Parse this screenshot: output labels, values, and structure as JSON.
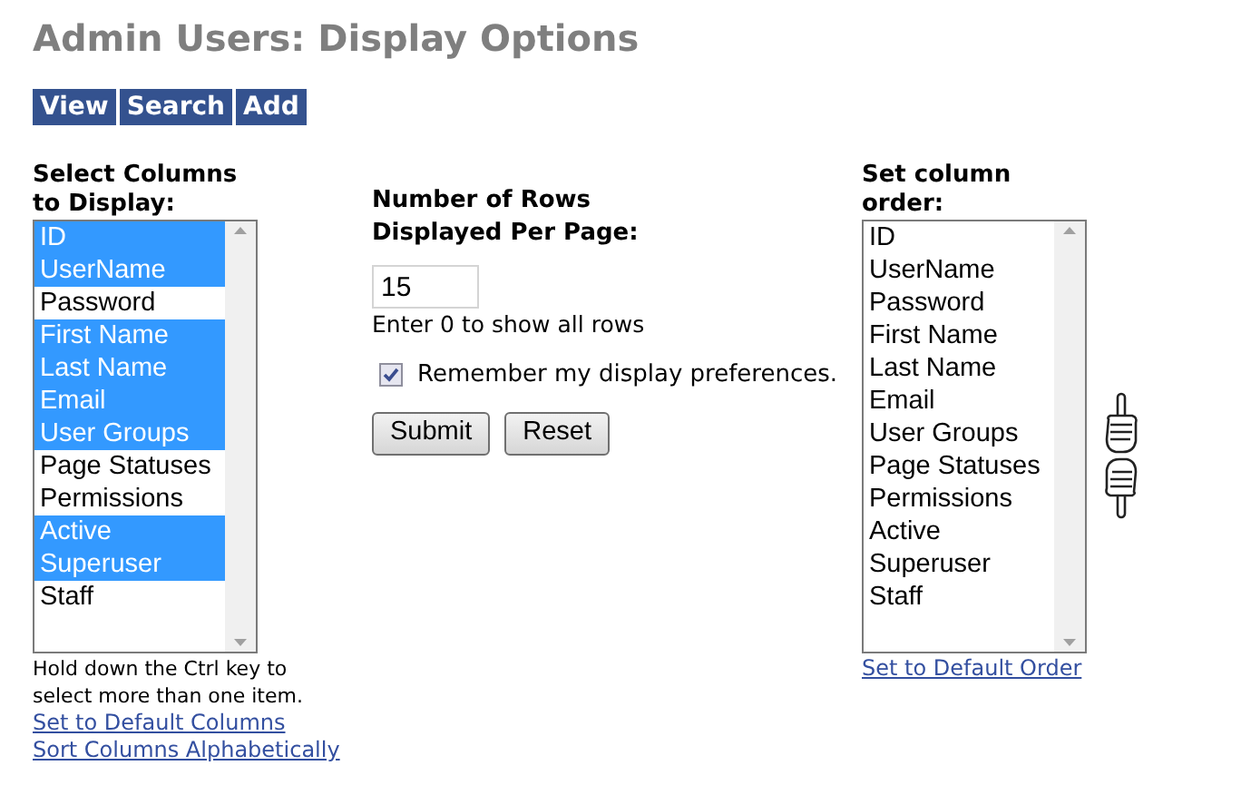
{
  "title": "Admin Users: Display Options",
  "nav": [
    "View",
    "Search",
    "Add"
  ],
  "select_columns": {
    "label": "Select Columns to Display:",
    "items": [
      {
        "label": "ID",
        "selected": true
      },
      {
        "label": "UserName",
        "selected": true
      },
      {
        "label": "Password",
        "selected": false
      },
      {
        "label": "First Name",
        "selected": true
      },
      {
        "label": "Last Name",
        "selected": true
      },
      {
        "label": "Email",
        "selected": true
      },
      {
        "label": "User Groups",
        "selected": true
      },
      {
        "label": "Page Statuses",
        "selected": false
      },
      {
        "label": "Permissions",
        "selected": false
      },
      {
        "label": "Active",
        "selected": true
      },
      {
        "label": "Superuser",
        "selected": true
      },
      {
        "label": "Staff",
        "selected": false
      }
    ],
    "hint": "Hold down the Ctrl key to select more than one item.",
    "links": [
      "Set to Default Columns",
      "Sort Columns Alphabetically"
    ]
  },
  "rows": {
    "label": "Number of Rows Displayed Per Page:",
    "value": "15",
    "hint": "Enter 0 to show all rows",
    "remember": {
      "label": "Remember my display preferences.",
      "checked": true
    },
    "buttons": [
      "Submit",
      "Reset"
    ]
  },
  "column_order": {
    "label": "Set column order:",
    "items": [
      {
        "label": "ID",
        "selected": false
      },
      {
        "label": "UserName",
        "selected": false
      },
      {
        "label": "Password",
        "selected": false
      },
      {
        "label": "First Name",
        "selected": false
      },
      {
        "label": "Last Name",
        "selected": false
      },
      {
        "label": "Email",
        "selected": false
      },
      {
        "label": "User Groups",
        "selected": false
      },
      {
        "label": "Page Statuses",
        "selected": false
      },
      {
        "label": "Permissions",
        "selected": false
      },
      {
        "label": "Active",
        "selected": false
      },
      {
        "label": "Superuser",
        "selected": false
      },
      {
        "label": "Staff",
        "selected": false
      }
    ],
    "link": "Set to Default Order"
  }
}
